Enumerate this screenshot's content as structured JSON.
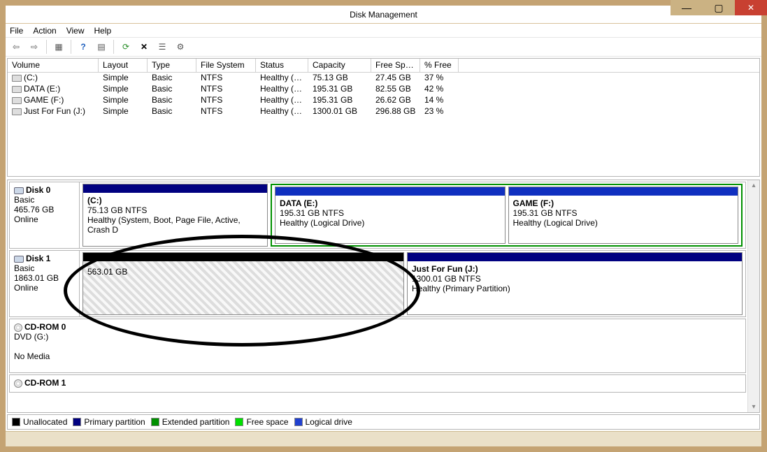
{
  "window": {
    "title": "Disk Management"
  },
  "titlebar_buttons": {
    "minimize": "—",
    "maximize": "▢",
    "close": "✕"
  },
  "menu": {
    "file": "File",
    "action": "Action",
    "view": "View",
    "help": "Help"
  },
  "columns": {
    "volume": "Volume",
    "layout": "Layout",
    "type": "Type",
    "fs": "File System",
    "status": "Status",
    "capacity": "Capacity",
    "free": "Free Spa...",
    "pct": "% Free"
  },
  "volumes": [
    {
      "name": "(C:)",
      "layout": "Simple",
      "type": "Basic",
      "fs": "NTFS",
      "status": "Healthy (S...",
      "capacity": "75.13 GB",
      "free": "27.45 GB",
      "pct": "37 %"
    },
    {
      "name": "DATA (E:)",
      "layout": "Simple",
      "type": "Basic",
      "fs": "NTFS",
      "status": "Healthy (L...",
      "capacity": "195.31 GB",
      "free": "82.55 GB",
      "pct": "42 %"
    },
    {
      "name": "GAME (F:)",
      "layout": "Simple",
      "type": "Basic",
      "fs": "NTFS",
      "status": "Healthy (L...",
      "capacity": "195.31 GB",
      "free": "26.62 GB",
      "pct": "14 %"
    },
    {
      "name": "Just For Fun (J:)",
      "layout": "Simple",
      "type": "Basic",
      "fs": "NTFS",
      "status": "Healthy (P...",
      "capacity": "1300.01 GB",
      "free": "296.88 GB",
      "pct": "23 %"
    }
  ],
  "disks": {
    "d0": {
      "label": "Disk 0",
      "type": "Basic",
      "size": "465.76 GB",
      "state": "Online"
    },
    "d1": {
      "label": "Disk 1",
      "type": "Basic",
      "size": "1863.01 GB",
      "state": "Online"
    },
    "cd0": {
      "label": "CD-ROM 0",
      "sub": "DVD (G:)",
      "state": "No Media"
    },
    "cd1": {
      "label": "CD-ROM 1"
    }
  },
  "partitions": {
    "c": {
      "title": "(C:)",
      "size": "75.13 GB NTFS",
      "status": "Healthy (System, Boot, Page File, Active, Crash D"
    },
    "e": {
      "title": "DATA  (E:)",
      "size": "195.31 GB NTFS",
      "status": "Healthy (Logical Drive)"
    },
    "f": {
      "title": "GAME  (F:)",
      "size": "195.31 GB NTFS",
      "status": "Healthy (Logical Drive)"
    },
    "unalloc": {
      "size": "563.01 GB"
    },
    "j": {
      "title": "Just For Fun  (J:)",
      "size": "1300.01 GB NTFS",
      "status": "Healthy (Primary Partition)"
    }
  },
  "legend": {
    "unallocated": "Unallocated",
    "primary": "Primary partition",
    "extended": "Extended partition",
    "free": "Free space",
    "logical": "Logical drive"
  }
}
